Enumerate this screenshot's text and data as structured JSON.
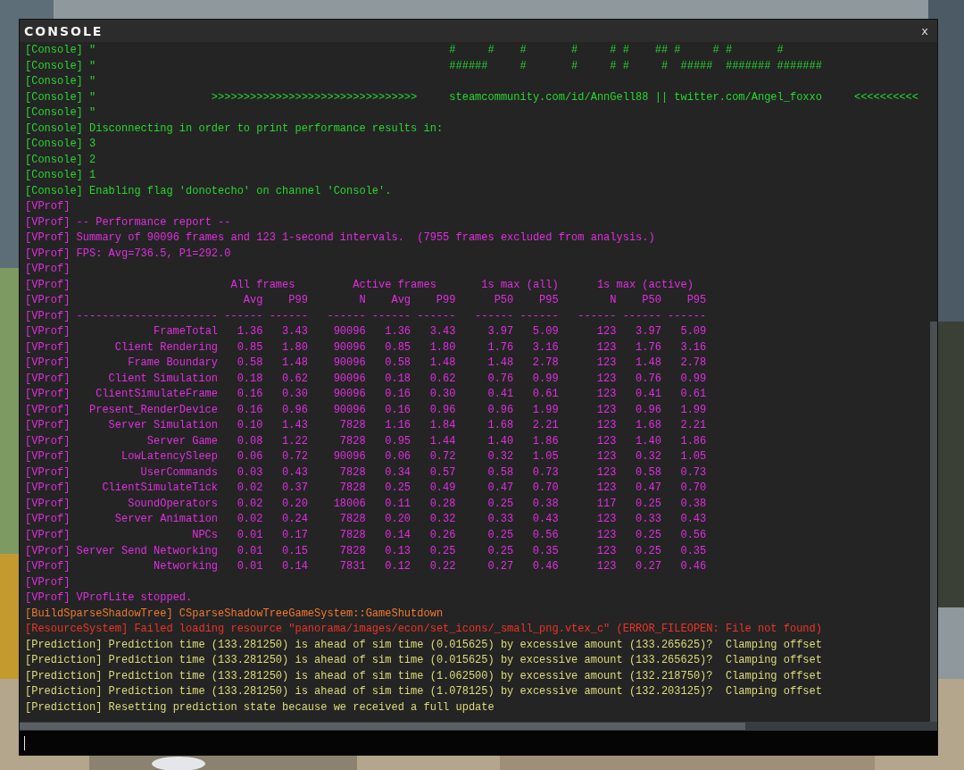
{
  "window": {
    "title": "CONSOLE",
    "close_label": "x"
  },
  "lines": [
    {
      "kind": "text",
      "color": "#27d62f",
      "text": "[Console] \"                                                       #     #    #       #     # #    ## #     # #       #"
    },
    {
      "kind": "text",
      "color": "#27d62f",
      "text": "[Console] \"                                                       ######     #       #     # #     #  #####  ####### #######"
    },
    {
      "kind": "text",
      "color": "#27d62f",
      "text": "[Console] \""
    },
    {
      "kind": "text",
      "color": "#27d62f",
      "text": "[Console] \"                  >>>>>>>>>>>>>>>>>>>>>>>>>>>>>>>>     steamcommunity.com/id/AnnGell88 || twitter.com/Angel_foxxo     <<<<<<<<<<"
    },
    {
      "kind": "text",
      "color": "#27d62f",
      "text": "[Console] \""
    },
    {
      "kind": "text",
      "color": "#27d62f",
      "text": "[Console] Disconnecting in order to print performance results in:"
    },
    {
      "kind": "text",
      "color": "#27d62f",
      "text": "[Console] 3"
    },
    {
      "kind": "text",
      "color": "#27d62f",
      "text": "[Console] 2"
    },
    {
      "kind": "text",
      "color": "#27d62f",
      "text": "[Console] 1"
    },
    {
      "kind": "text",
      "color": "#27d62f",
      "text": "[Console] Enabling flag 'donotecho' on channel 'Console'."
    },
    {
      "kind": "text",
      "color": "#e02ee0",
      "text": "[VProf]"
    },
    {
      "kind": "text",
      "color": "#e02ee0",
      "text": "[VProf] -- Performance report --"
    },
    {
      "kind": "text",
      "color": "#e02ee0",
      "text": "[VProf] Summary of 90096 frames and 123 1-second intervals.  (7955 frames excluded from analysis.)"
    },
    {
      "kind": "text",
      "color": "#e02ee0",
      "text": "[VProf] FPS: Avg=736.5, P1=292.0"
    },
    {
      "kind": "text",
      "color": "#e02ee0",
      "text": "[VProf]"
    },
    {
      "kind": "text",
      "color": "#e02ee0",
      "text": "[VProf]                         All frames         Active frames       1s max (all)      1s max (active)"
    },
    {
      "kind": "header",
      "color": "#e02ee0",
      "tag": "[VProf]",
      "cells": [
        "Avg",
        "P99",
        "N",
        "Avg",
        "P99",
        "P50",
        "P95",
        "N",
        "P50",
        "P95"
      ]
    },
    {
      "kind": "rule",
      "color": "#e02ee0",
      "tag": "[VProf]",
      "cells": [
        "----------------------",
        "------",
        "------",
        "------",
        "------",
        "------",
        "------",
        "------",
        "------",
        "------",
        "------"
      ]
    },
    {
      "kind": "row",
      "color": "#e02ee0",
      "tag": "[VProf]",
      "cells": [
        "FrameTotal",
        "1.36",
        "3.43",
        "90096",
        "1.36",
        "3.43",
        "3.97",
        "5.09",
        "123",
        "3.97",
        "5.09"
      ]
    },
    {
      "kind": "row",
      "color": "#e02ee0",
      "tag": "[VProf]",
      "cells": [
        "Client Rendering",
        "0.85",
        "1.80",
        "90096",
        "0.85",
        "1.80",
        "1.76",
        "3.16",
        "123",
        "1.76",
        "3.16"
      ]
    },
    {
      "kind": "row",
      "color": "#e02ee0",
      "tag": "[VProf]",
      "cells": [
        "Frame Boundary",
        "0.58",
        "1.48",
        "90096",
        "0.58",
        "1.48",
        "1.48",
        "2.78",
        "123",
        "1.48",
        "2.78"
      ]
    },
    {
      "kind": "row",
      "color": "#e02ee0",
      "tag": "[VProf]",
      "cells": [
        "Client Simulation",
        "0.18",
        "0.62",
        "90096",
        "0.18",
        "0.62",
        "0.76",
        "0.99",
        "123",
        "0.76",
        "0.99"
      ]
    },
    {
      "kind": "row",
      "color": "#e02ee0",
      "tag": "[VProf]",
      "cells": [
        "ClientSimulateFrame",
        "0.16",
        "0.30",
        "90096",
        "0.16",
        "0.30",
        "0.41",
        "0.61",
        "123",
        "0.41",
        "0.61"
      ]
    },
    {
      "kind": "row",
      "color": "#e02ee0",
      "tag": "[VProf]",
      "cells": [
        "Present_RenderDevice",
        "0.16",
        "0.96",
        "90096",
        "0.16",
        "0.96",
        "0.96",
        "1.99",
        "123",
        "0.96",
        "1.99"
      ]
    },
    {
      "kind": "row",
      "color": "#e02ee0",
      "tag": "[VProf]",
      "cells": [
        "Server Simulation",
        "0.10",
        "1.43",
        "7828",
        "1.16",
        "1.84",
        "1.68",
        "2.21",
        "123",
        "1.68",
        "2.21"
      ]
    },
    {
      "kind": "row",
      "color": "#e02ee0",
      "tag": "[VProf]",
      "cells": [
        "Server Game",
        "0.08",
        "1.22",
        "7828",
        "0.95",
        "1.44",
        "1.40",
        "1.86",
        "123",
        "1.40",
        "1.86"
      ]
    },
    {
      "kind": "row",
      "color": "#e02ee0",
      "tag": "[VProf]",
      "cells": [
        "LowLatencySleep",
        "0.06",
        "0.72",
        "90096",
        "0.06",
        "0.72",
        "0.32",
        "1.05",
        "123",
        "0.32",
        "1.05"
      ]
    },
    {
      "kind": "row",
      "color": "#e02ee0",
      "tag": "[VProf]",
      "cells": [
        "UserCommands",
        "0.03",
        "0.43",
        "7828",
        "0.34",
        "0.57",
        "0.58",
        "0.73",
        "123",
        "0.58",
        "0.73"
      ]
    },
    {
      "kind": "row",
      "color": "#e02ee0",
      "tag": "[VProf]",
      "cells": [
        "ClientSimulateTick",
        "0.02",
        "0.37",
        "7828",
        "0.25",
        "0.49",
        "0.47",
        "0.70",
        "123",
        "0.47",
        "0.70"
      ]
    },
    {
      "kind": "row",
      "color": "#e02ee0",
      "tag": "[VProf]",
      "cells": [
        "SoundOperators",
        "0.02",
        "0.20",
        "18006",
        "0.11",
        "0.28",
        "0.25",
        "0.38",
        "117",
        "0.25",
        "0.38"
      ]
    },
    {
      "kind": "row",
      "color": "#e02ee0",
      "tag": "[VProf]",
      "cells": [
        "Server Animation",
        "0.02",
        "0.24",
        "7828",
        "0.20",
        "0.32",
        "0.33",
        "0.43",
        "123",
        "0.33",
        "0.43"
      ]
    },
    {
      "kind": "row",
      "color": "#e02ee0",
      "tag": "[VProf]",
      "cells": [
        "NPCs",
        "0.01",
        "0.17",
        "7828",
        "0.14",
        "0.26",
        "0.25",
        "0.56",
        "123",
        "0.25",
        "0.56"
      ]
    },
    {
      "kind": "row",
      "color": "#e02ee0",
      "tag": "[VProf]",
      "cells": [
        "Server Send Networking",
        "0.01",
        "0.15",
        "7828",
        "0.13",
        "0.25",
        "0.25",
        "0.35",
        "123",
        "0.25",
        "0.35"
      ]
    },
    {
      "kind": "row",
      "color": "#e02ee0",
      "tag": "[VProf]",
      "cells": [
        "Networking",
        "0.01",
        "0.14",
        "7831",
        "0.12",
        "0.22",
        "0.27",
        "0.46",
        "123",
        "0.27",
        "0.46"
      ]
    },
    {
      "kind": "text",
      "color": "#e02ee0",
      "text": "[VProf]"
    },
    {
      "kind": "text",
      "color": "#e02ee0",
      "text": "[VProf] VProfLite stopped."
    },
    {
      "kind": "text",
      "color": "#f07a30",
      "text": "[BuildSparseShadowTree] CSparseShadowTreeGameSystem::GameShutdown"
    },
    {
      "kind": "text",
      "color": "#ee3424",
      "text": "[ResourceSystem] Failed loading resource \"panorama/images/econ/set_icons/_small_png.vtex_c\" (ERROR_FILEOPEN: File not found)"
    },
    {
      "kind": "text",
      "color": "#dcdc78",
      "text": "[Prediction] Prediction time (133.281250) is ahead of sim time (0.015625) by excessive amount (133.265625)?  Clamping offset"
    },
    {
      "kind": "text",
      "color": "#dcdc78",
      "text": "[Prediction] Prediction time (133.281250) is ahead of sim time (0.015625) by excessive amount (133.265625)?  Clamping offset"
    },
    {
      "kind": "text",
      "color": "#dcdc78",
      "text": "[Prediction] Prediction time (133.281250) is ahead of sim time (1.062500) by excessive amount (132.218750)?  Clamping offset"
    },
    {
      "kind": "text",
      "color": "#dcdc78",
      "text": "[Prediction] Prediction time (133.281250) is ahead of sim time (1.078125) by excessive amount (132.203125)?  Clamping offset"
    },
    {
      "kind": "text",
      "color": "#dcdc78",
      "text": "[Prediction] Resetting prediction state because we received a full update"
    }
  ]
}
